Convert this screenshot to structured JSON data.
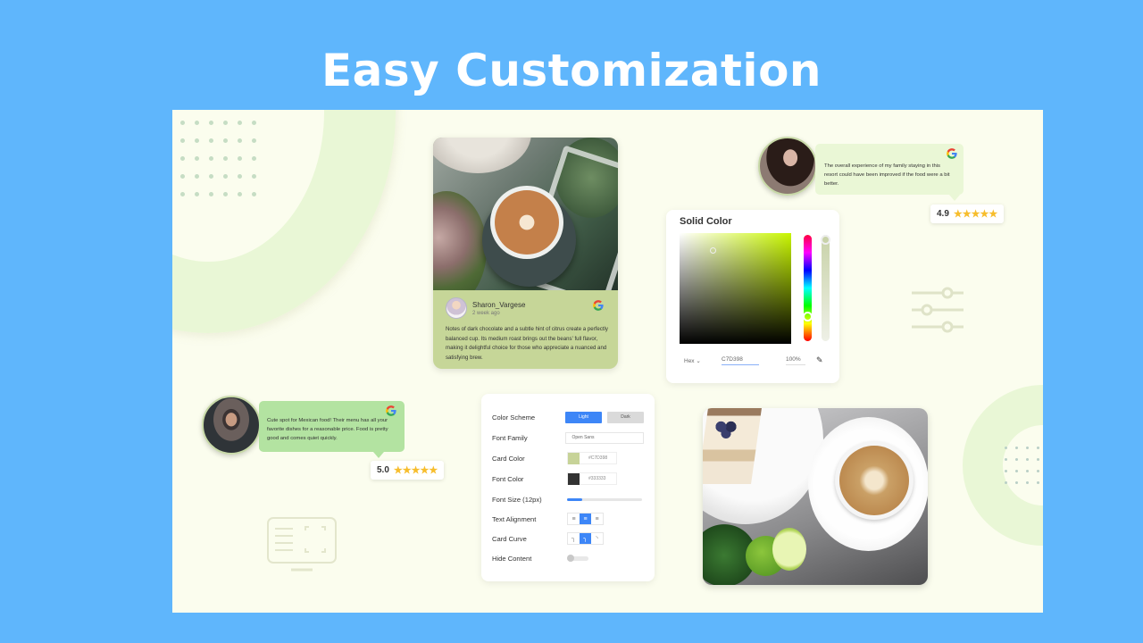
{
  "page": {
    "title": "Easy Customization",
    "colors": {
      "background": "#5fb6fc",
      "canvas": "#fbfdee",
      "accent_blue": "#3d86f7",
      "card_green": "#c6d698",
      "bubble_green": "#b3e3a1",
      "bubble_light_green": "#eaf7d6",
      "star": "#f7bd2c"
    }
  },
  "photo_review_card": {
    "image": "latte-art-coffee-cup-photo",
    "reviewer_name": "Sharon_Vargese",
    "time": "2 week ago",
    "source_icon": "google-icon",
    "text": "Notes of dark chocolate and a subtle hint of citrus create a perfectly balanced cup. Its medium roast brings out the beans' full flavor, making it delightful choice for those who appreciate a nuanced and satisfying brew."
  },
  "color_picker": {
    "title": "Solid Color",
    "mode": "Hex",
    "hex_value": "C7D398",
    "alpha": "100%",
    "eyedropper_icon": "eyedropper-icon"
  },
  "reviews": [
    {
      "text": "The overall experience of my family staying in this resort could have been improved if the food were a bit better.",
      "rating": "4.9",
      "stars": "★★★★★",
      "source_icon": "google-icon"
    },
    {
      "text": "Cute spot for Mexican food! Their menu has all your favorite dishes for a reasonable price. Food is pretty good and comes quiet quickly.",
      "rating": "5.0",
      "stars": "★★★★★",
      "source_icon": "google-icon"
    }
  ],
  "settings": {
    "color_scheme": {
      "label": "Color Scheme",
      "options": [
        "Light",
        "Dark"
      ],
      "selected": "Light"
    },
    "font_family": {
      "label": "Font Family",
      "value": "Open Sans"
    },
    "card_color": {
      "label": "Card Color",
      "value": "#C7D398",
      "swatch": "#c7d398"
    },
    "font_color": {
      "label": "Font Color",
      "value": "#333333",
      "swatch": "#333333"
    },
    "font_size": {
      "label": "Font Size (12px)",
      "value_fraction": 0.2
    },
    "text_alignment": {
      "label": "Text Alignment",
      "options": [
        "left",
        "center",
        "right"
      ],
      "selected": "center"
    },
    "card_curve": {
      "label": "Card Curve",
      "options": [
        "none",
        "medium",
        "round"
      ],
      "selected": "medium"
    },
    "hide_content": {
      "label": "Hide Content",
      "enabled": false
    }
  },
  "photo2": {
    "image": "coffee-cake-lime-photo"
  }
}
